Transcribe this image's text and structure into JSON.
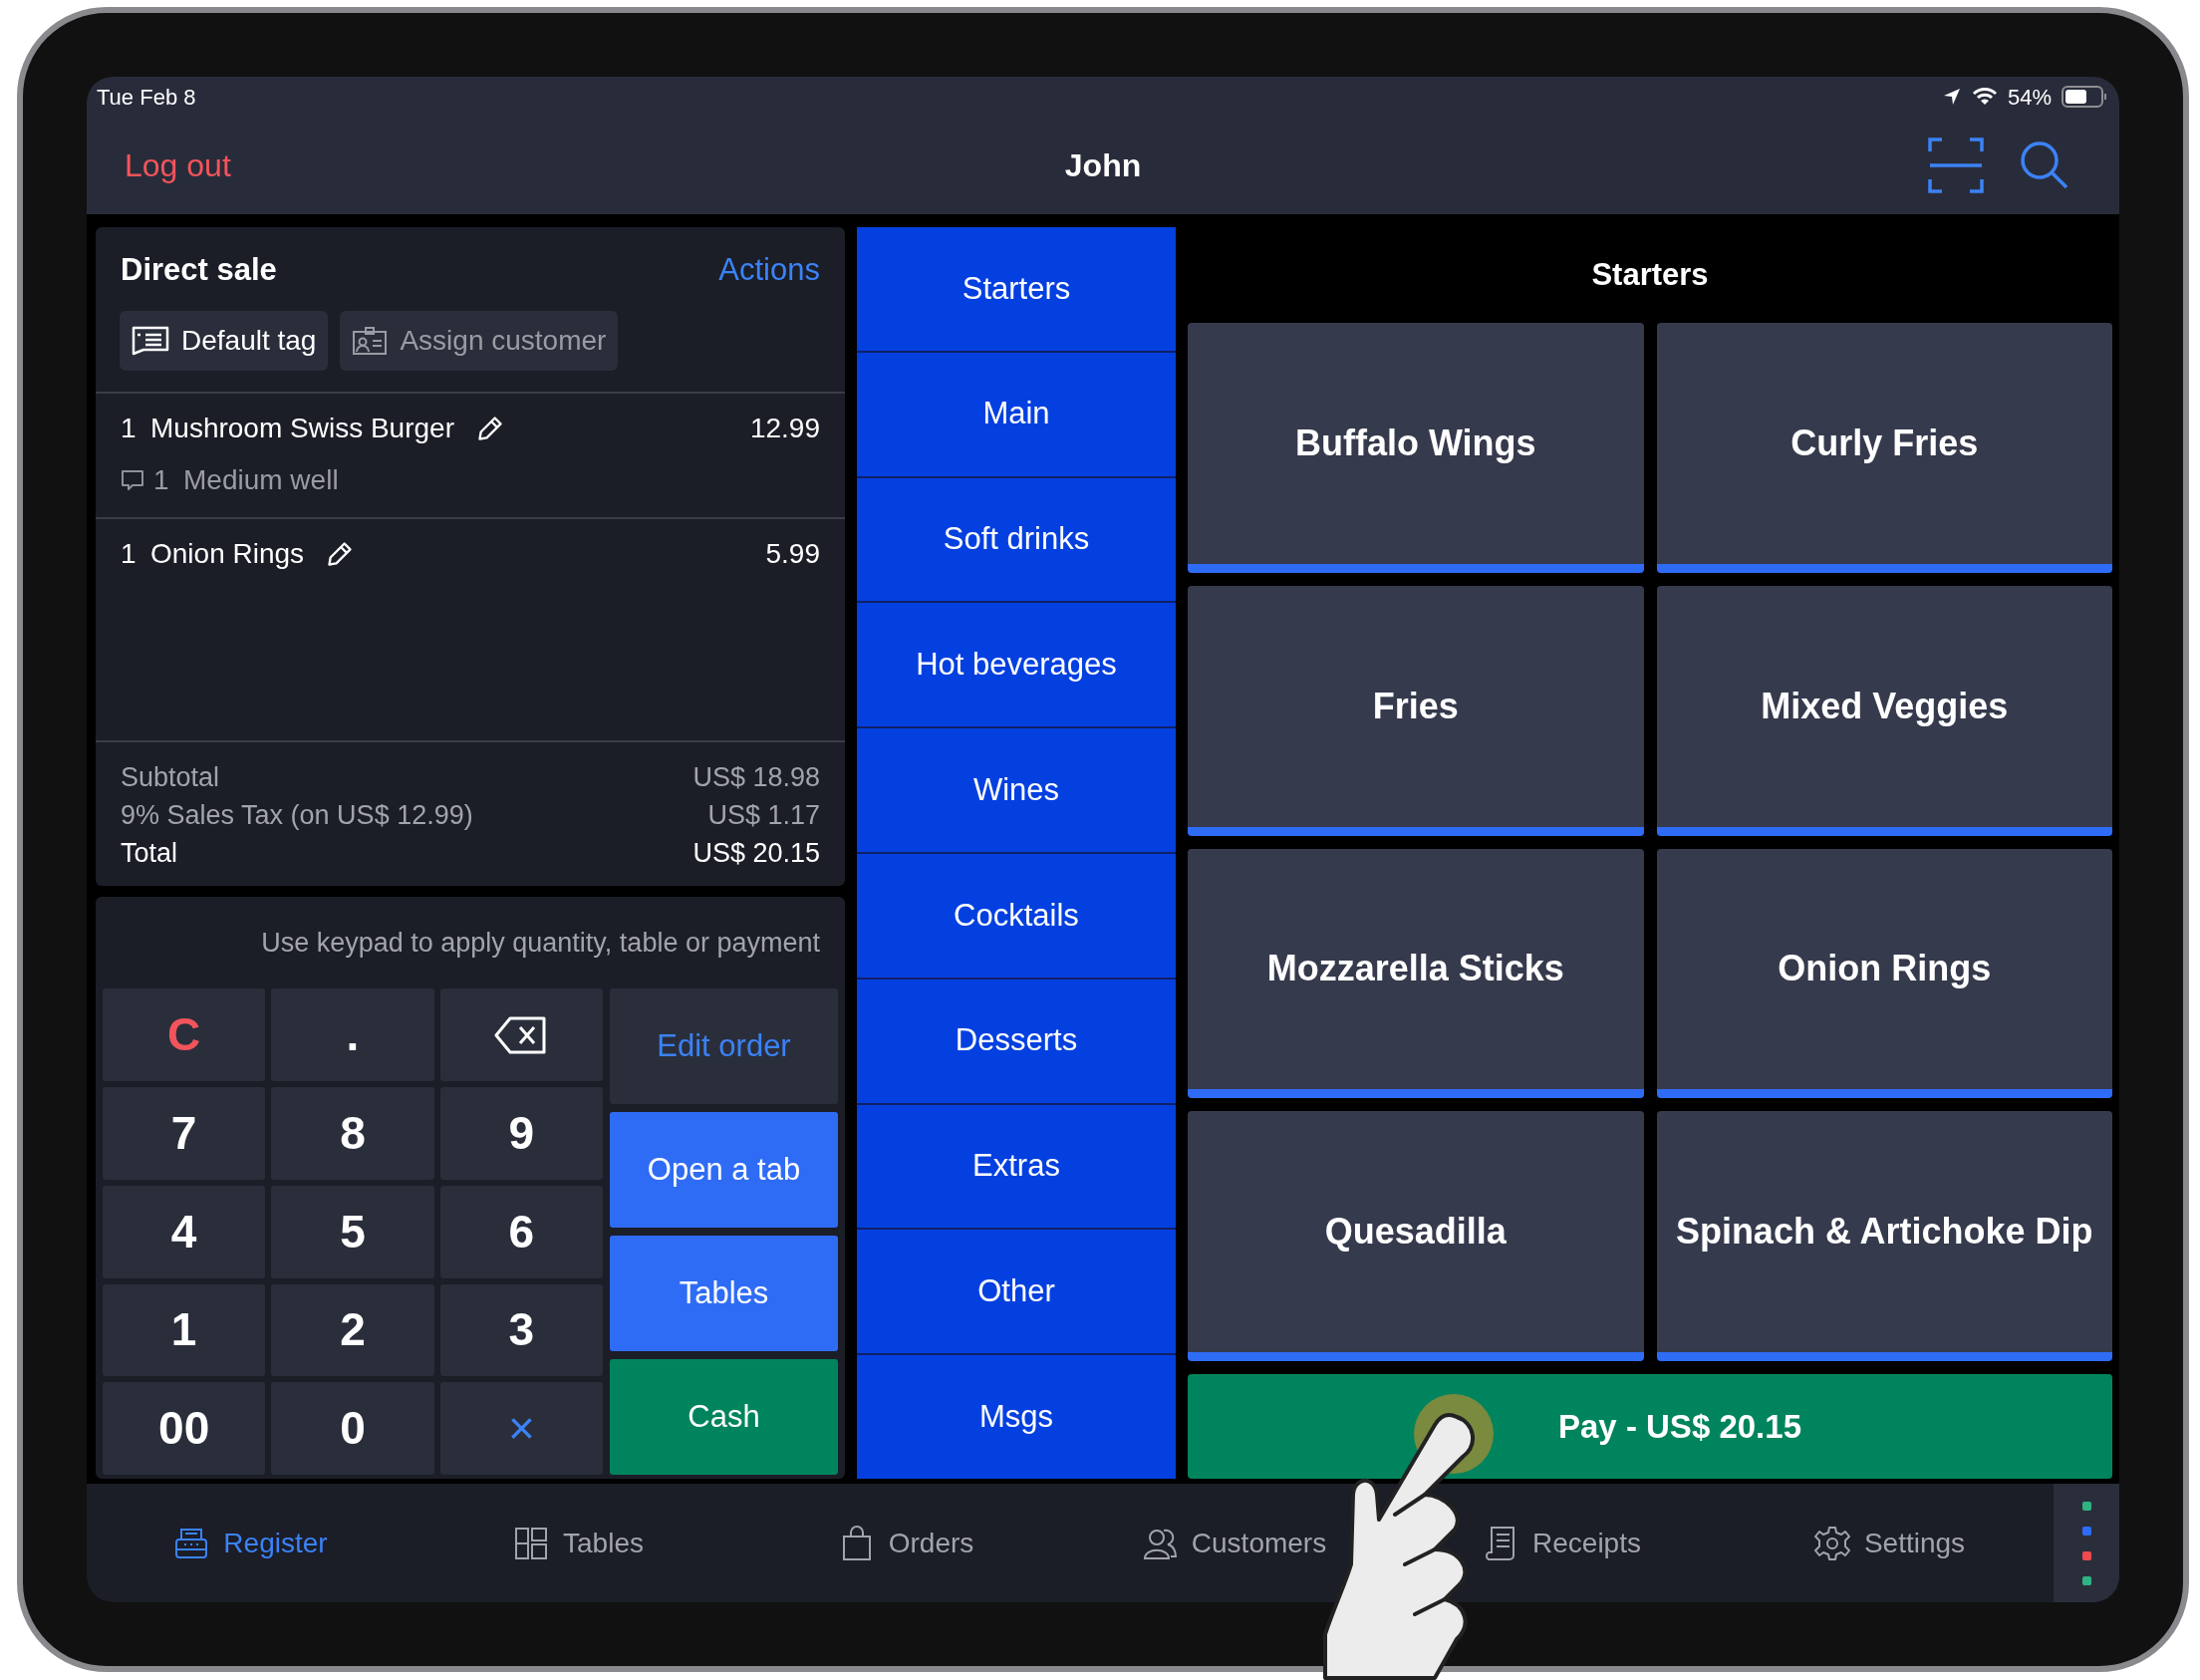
{
  "status_bar": {
    "date": "Tue Feb 8",
    "battery": "54%"
  },
  "header": {
    "logout": "Log out",
    "title": "John"
  },
  "order": {
    "title": "Direct sale",
    "actions": "Actions",
    "tag": "Default tag",
    "customer": "Assign customer",
    "lines": [
      {
        "qty": "1",
        "name": "Mushroom Swiss Burger",
        "price": "12.99",
        "notes": [
          {
            "qty": "1",
            "text": "Medium well"
          }
        ]
      },
      {
        "qty": "1",
        "name": "Onion Rings",
        "price": "5.99"
      }
    ],
    "totals": [
      {
        "kind": "sub",
        "label": "Subtotal",
        "value": "US$ 18.98"
      },
      {
        "kind": "sub",
        "label": "9% Sales Tax (on US$ 12.99)",
        "value": "US$ 1.17"
      },
      {
        "kind": "total",
        "label": "Total",
        "value": "US$ 20.15"
      }
    ]
  },
  "keypad": {
    "hint": "Use keypad to apply quantity, table or payment",
    "keys": [
      {
        "kind": "clear",
        "label": "C"
      },
      {
        "kind": "digit",
        "label": "."
      },
      {
        "kind": "backspace"
      },
      {
        "kind": "digit",
        "label": "7"
      },
      {
        "kind": "digit",
        "label": "8"
      },
      {
        "kind": "digit",
        "label": "9"
      },
      {
        "kind": "digit",
        "label": "4"
      },
      {
        "kind": "digit",
        "label": "5"
      },
      {
        "kind": "digit",
        "label": "6"
      },
      {
        "kind": "digit",
        "label": "1"
      },
      {
        "kind": "digit",
        "label": "2"
      },
      {
        "kind": "digit",
        "label": "3"
      },
      {
        "kind": "digit",
        "label": "00"
      },
      {
        "kind": "digit",
        "label": "0"
      },
      {
        "kind": "multiply",
        "label": "×"
      }
    ],
    "actions": [
      {
        "kind": "link",
        "label": "Edit order"
      },
      {
        "kind": "primary",
        "label": "Open a tab"
      },
      {
        "kind": "primary",
        "label": "Tables"
      },
      {
        "kind": "success",
        "label": "Cash"
      }
    ]
  },
  "categories": [
    "Starters",
    "Main",
    "Soft drinks",
    "Hot beverages",
    "Wines",
    "Cocktails",
    "Desserts",
    "Extras",
    "Other",
    "Msgs"
  ],
  "products": {
    "title": "Starters",
    "items": [
      "Buffalo Wings",
      "Curly Fries",
      "Fries",
      "Mixed Veggies",
      "Mozzarella Sticks",
      "Onion Rings",
      "Quesadilla",
      "Spinach & Artichoke Dip"
    ],
    "pay": "Pay - US$ 20.15"
  },
  "tabs": [
    {
      "kind": "register",
      "label": "Register",
      "selected": true
    },
    {
      "kind": "tables",
      "label": "Tables",
      "selected": false
    },
    {
      "kind": "orders",
      "label": "Orders",
      "selected": false
    },
    {
      "kind": "customers",
      "label": "Customers",
      "selected": false
    },
    {
      "kind": "receipts",
      "label": "Receipts",
      "selected": false
    },
    {
      "kind": "settings",
      "label": "Settings",
      "selected": false
    }
  ],
  "indicator_dots": [
    {
      "color": "#2fb383"
    },
    {
      "color": "#2f6cf5"
    },
    {
      "color": "#f0494f"
    },
    {
      "color": "#2fb383"
    }
  ]
}
